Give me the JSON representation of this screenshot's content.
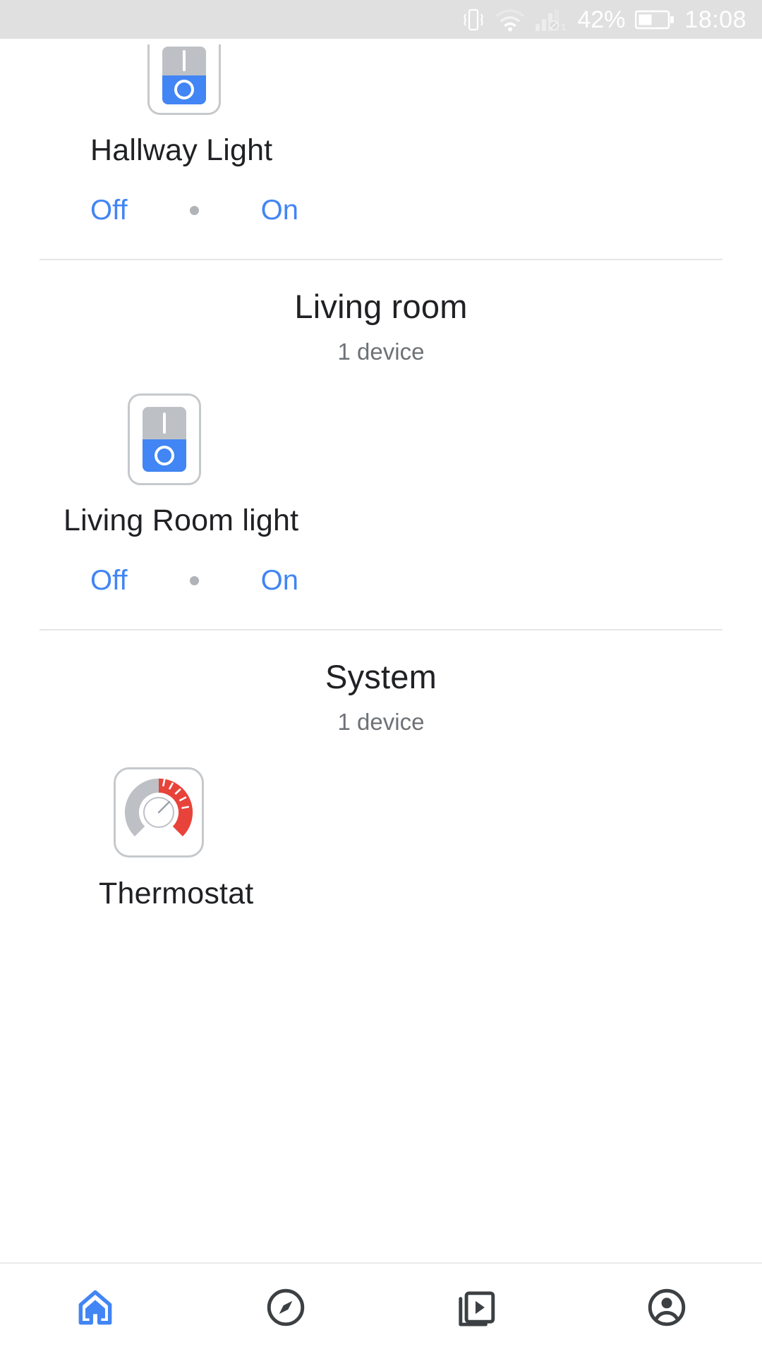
{
  "status_bar": {
    "background": "#e0e0e0",
    "foreground": "#ffffff",
    "battery_percent": "42%",
    "time": "18:08",
    "icons": [
      "vibrate-icon",
      "wifi-icon",
      "cell-signal-icon",
      "battery-icon"
    ],
    "signal_label": "1"
  },
  "colors": {
    "accent_blue": "#4285f4",
    "switch_gray": "#bdc1c6",
    "gauge_red": "#e8433a",
    "gauge_gray": "#bdc1c6",
    "text_primary": "#202124",
    "text_secondary": "#6e7276",
    "divider": "#e4e6e8"
  },
  "sections": [
    {
      "id": "hallway-partial",
      "title": "",
      "subtitle": "",
      "devices": [
        {
          "name": "Hallway Light",
          "icon": "light-switch-icon",
          "controls": {
            "off_label": "Off",
            "on_label": "On",
            "separator": "dot"
          }
        }
      ]
    },
    {
      "id": "living-room",
      "title": "Living room",
      "subtitle": "1 device",
      "devices": [
        {
          "name": "Living Room light",
          "icon": "light-switch-icon",
          "controls": {
            "off_label": "Off",
            "on_label": "On",
            "separator": "dot"
          }
        }
      ]
    },
    {
      "id": "system",
      "title": "System",
      "subtitle": "1 device",
      "devices": [
        {
          "name": "Thermostat",
          "icon": "thermostat-gauge-icon",
          "controls": null
        }
      ]
    }
  ],
  "bottom_nav": {
    "items": [
      {
        "id": "home",
        "icon": "home-icon",
        "active": true
      },
      {
        "id": "explore",
        "icon": "compass-icon",
        "active": false
      },
      {
        "id": "media",
        "icon": "media-library-icon",
        "active": false
      },
      {
        "id": "account",
        "icon": "account-circle-icon",
        "active": false
      }
    ],
    "active_color": "#4285f4",
    "inactive_color": "#3c4043"
  }
}
